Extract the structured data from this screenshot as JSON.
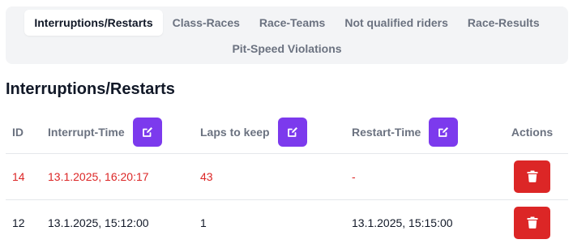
{
  "tabs": [
    {
      "label": "Interruptions/Restarts",
      "active": true
    },
    {
      "label": "Class-Races",
      "active": false
    },
    {
      "label": "Race-Teams",
      "active": false
    },
    {
      "label": "Not qualified riders",
      "active": false
    },
    {
      "label": "Race-Results",
      "active": false
    },
    {
      "label": "Pit-Speed Violations",
      "active": false
    }
  ],
  "page_title": "Interruptions/Restarts",
  "table": {
    "headers": {
      "id": "ID",
      "interrupt_time": "Interrupt-Time",
      "laps_to_keep": "Laps to keep",
      "restart_time": "Restart-Time",
      "actions": "Actions"
    },
    "rows": [
      {
        "id": "14",
        "interrupt_time": "13.1.2025, 16:20:17",
        "laps_to_keep": "43",
        "restart_time": "-",
        "highlight": true
      },
      {
        "id": "12",
        "interrupt_time": "13.1.2025, 15:12:00",
        "laps_to_keep": "1",
        "restart_time": "13.1.2025, 15:15:00",
        "highlight": false
      }
    ]
  },
  "icons": {
    "edit": "edit-icon",
    "delete": "trash-icon"
  },
  "colors": {
    "accent": "#7c3aed",
    "danger": "#dc2626",
    "highlight_text": "#dc2626"
  }
}
